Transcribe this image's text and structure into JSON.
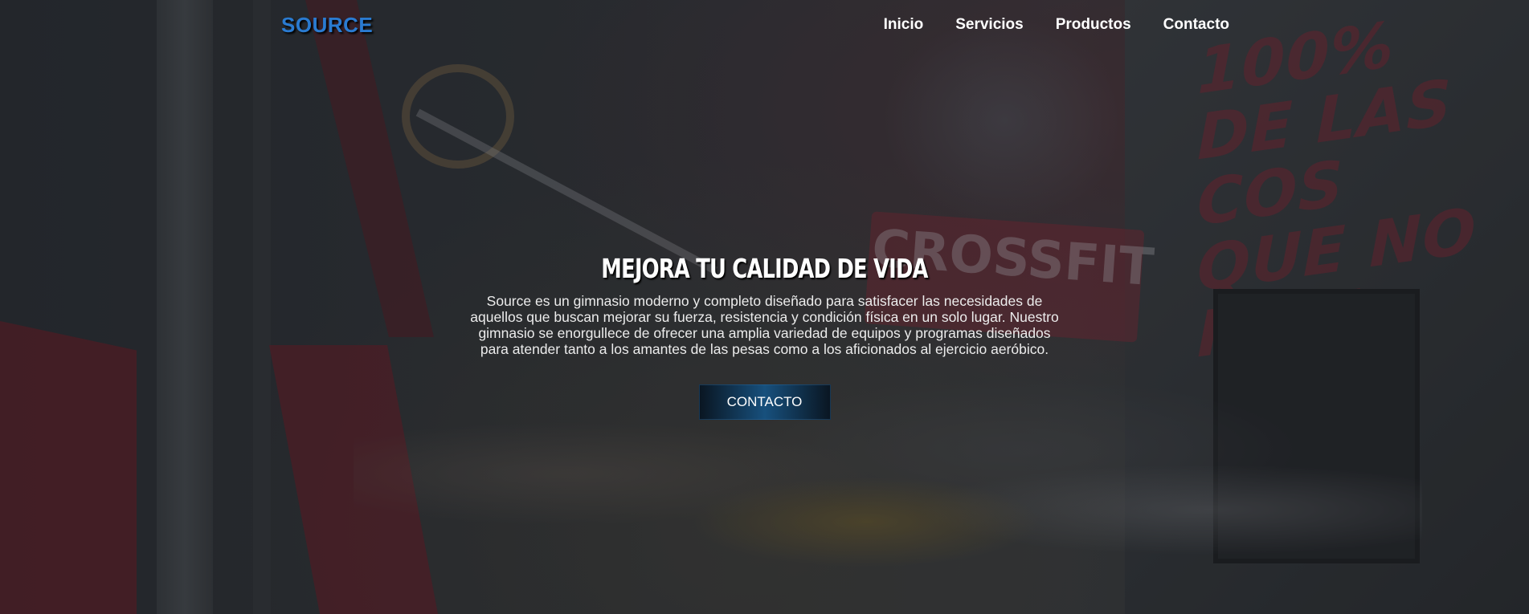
{
  "header": {
    "logo": "SOURCE",
    "nav": [
      "Inicio",
      "Servicios",
      "Productos",
      "Contacto"
    ]
  },
  "hero": {
    "headline": "MEJORA TU CALIDAD DE VIDA",
    "description_lines": [
      "Source es un gimnasio moderno y completo diseñado para satisfacer las necesidades de",
      "aquellos que buscan mejorar su fuerza, resistencia y condición física en un solo lugar. Nuestro",
      "gimnasio se enorgullece de ofrecer una amplia variedad de equipos y programas diseñados",
      "para atender tanto a los amantes de las pesas como a los aficionados al ejercicio aeróbico."
    ],
    "cta_label": "CONTACTO",
    "background_wall_text": [
      "100%",
      "DE LAS COS",
      "QUE NO INTE"
    ],
    "background_sign_text": "CROSSFIT"
  },
  "colors": {
    "logo": "#2a7bd1",
    "text": "#ffffff",
    "cta_center": "#17507d",
    "cta_edge": "#0a1622"
  }
}
